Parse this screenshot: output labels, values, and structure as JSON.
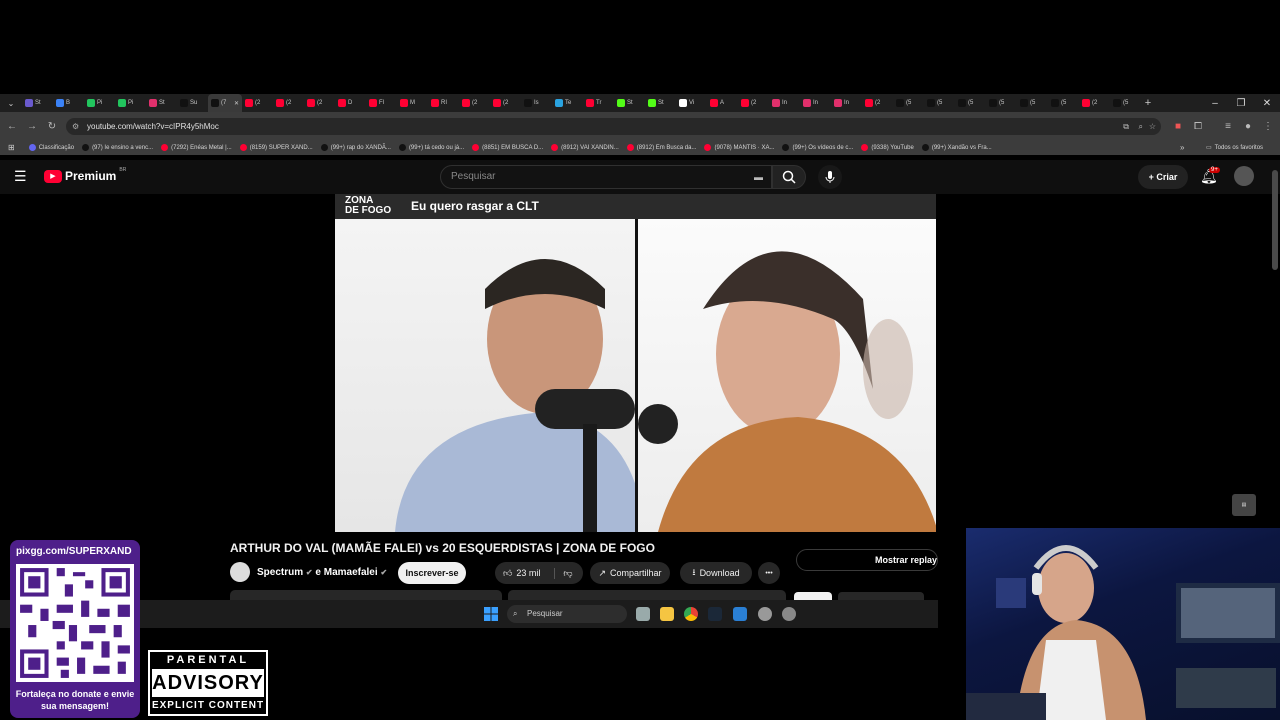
{
  "browser": {
    "tabs": [
      {
        "label": "St",
        "color": "#6a5acd"
      },
      {
        "label": "B",
        "color": "#3b82f6"
      },
      {
        "label": "Pi",
        "color": "#22c55e"
      },
      {
        "label": "Pi",
        "color": "#22c55e"
      },
      {
        "label": "St",
        "color": "#e1306c"
      },
      {
        "label": "Su",
        "color": "#111111"
      },
      {
        "label": "(7",
        "color": "#111111",
        "active": true
      },
      {
        "label": "(2",
        "color": "#ff0033"
      },
      {
        "label": "(2",
        "color": "#ff0033"
      },
      {
        "label": "(2",
        "color": "#ff0033"
      },
      {
        "label": "D",
        "color": "#ff0033"
      },
      {
        "label": "Fl",
        "color": "#ff0033"
      },
      {
        "label": "M",
        "color": "#ff0033"
      },
      {
        "label": "RI",
        "color": "#ff0033"
      },
      {
        "label": "(2",
        "color": "#ff0033"
      },
      {
        "label": "(2",
        "color": "#ff0033"
      },
      {
        "label": "Is",
        "color": "#111111"
      },
      {
        "label": "Te",
        "color": "#2aa3e0"
      },
      {
        "label": "Tr",
        "color": "#ff0033"
      },
      {
        "label": "St",
        "color": "#53fc18"
      },
      {
        "label": "St",
        "color": "#53fc18"
      },
      {
        "label": "Vi",
        "color": "#ffffff"
      },
      {
        "label": "A",
        "color": "#ff0033"
      },
      {
        "label": "(2",
        "color": "#ff0033"
      },
      {
        "label": "In",
        "color": "#e1306c"
      },
      {
        "label": "In",
        "color": "#e1306c"
      },
      {
        "label": "In",
        "color": "#e1306c"
      },
      {
        "label": "(2",
        "color": "#ff0033"
      },
      {
        "label": "(5",
        "color": "#111111"
      },
      {
        "label": "(5",
        "color": "#111111"
      },
      {
        "label": "(5",
        "color": "#111111"
      },
      {
        "label": "(5",
        "color": "#111111"
      },
      {
        "label": "(5",
        "color": "#111111"
      },
      {
        "label": "(5",
        "color": "#111111"
      },
      {
        "label": "(2",
        "color": "#ff0033"
      },
      {
        "label": "(5",
        "color": "#111111"
      }
    ],
    "new_tab": "+",
    "url": "youtube.com/watch?v=cIPR4y5hMoc",
    "bookmarks": [
      {
        "label": "Classificação",
        "color": "#6366f1"
      },
      {
        "label": "(97) Ie ensino a venc...",
        "color": "#111111"
      },
      {
        "label": "(7292) Enéas Metal |...",
        "color": "#ff0033"
      },
      {
        "label": "(8159) SUPER XAND...",
        "color": "#ff0033"
      },
      {
        "label": "(99+) rap do XANDÃ...",
        "color": "#111111"
      },
      {
        "label": "(99+) tá cedo ou já...",
        "color": "#111111"
      },
      {
        "label": "(8851) EM BUSCA D...",
        "color": "#ff0033"
      },
      {
        "label": "(8912) VAI XANDIN...",
        "color": "#ff0033"
      },
      {
        "label": "(8912) Em Busca da...",
        "color": "#ff0033"
      },
      {
        "label": "(9078) MANTIS · XA...",
        "color": "#ff0033"
      },
      {
        "label": "(99+) Os vídeos de c...",
        "color": "#111111"
      },
      {
        "label": "(9338) YouTube",
        "color": "#ff0033"
      },
      {
        "label": "(99+) Xandão vs Fra...",
        "color": "#111111"
      }
    ],
    "all_favorites": "Todos os favoritos"
  },
  "youtube": {
    "logo_text": "Premium",
    "logo_region": "BR",
    "search_placeholder": "Pesquisar",
    "create_label": "Criar",
    "notif_count": "9+",
    "video_banner_brand_line1": "ZONA",
    "video_banner_brand_line2": "DE FOGO",
    "video_banner_text": "Eu quero rasgar a CLT",
    "video_title": "ARTHUR DO VAL (MAMÃE FALEI) vs 20 ESQUERDISTAS | ZONA DE FOGO",
    "channel": "Spectrum",
    "channel_joiner": "e",
    "collab_channel": "Mamaefalei",
    "subscribe_label": "Inscrever-se",
    "likes": "23 mil",
    "share_label": "Compartilhar",
    "download_label": "Download",
    "more_label": "•••",
    "chat_replay_label": "Mostrar replay do"
  },
  "taskbar": {
    "search_placeholder": "Pesquisar"
  },
  "overlay": {
    "donate_url": "pixgg.com/SUPERXAND",
    "donate_message": "Fortaleça no donate e envie sua mensagem!",
    "advisory_top": "PARENTAL",
    "advisory_mid": "ADVISORY",
    "advisory_bot": "EXPLICIT CONTENT"
  },
  "colors": {
    "youtube_red": "#ff0033",
    "donate_purple": "#4e1f8a"
  }
}
